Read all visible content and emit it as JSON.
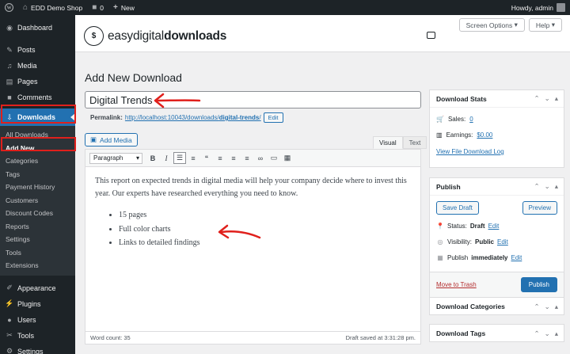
{
  "adminbar": {
    "site_name": "EDD Demo Shop",
    "comments_count": "0",
    "new_label": "New",
    "greeting": "Howdy, admin"
  },
  "sidebar": {
    "top_items": [
      {
        "label": "Dashboard",
        "icon": "dashboard-icon"
      },
      {
        "label": "Posts",
        "icon": "pin-icon"
      },
      {
        "label": "Media",
        "icon": "media-icon"
      },
      {
        "label": "Pages",
        "icon": "pages-icon"
      },
      {
        "label": "Comments",
        "icon": "comment-icon"
      }
    ],
    "downloads_label": "Downloads",
    "submenu": [
      "All Downloads",
      "Add New",
      "Categories",
      "Tags",
      "Payment History",
      "Customers",
      "Discount Codes",
      "Reports",
      "Settings",
      "Tools",
      "Extensions"
    ],
    "bottom_items": [
      {
        "label": "Appearance",
        "icon": "appearance-icon"
      },
      {
        "label": "Plugins",
        "icon": "plugin-icon"
      },
      {
        "label": "Users",
        "icon": "users-icon"
      },
      {
        "label": "Tools",
        "icon": "tools-icon"
      },
      {
        "label": "Settings",
        "icon": "settings-icon"
      }
    ]
  },
  "header": {
    "logo_light1": "easy",
    "logo_light2": "digital",
    "logo_bold": "downloads",
    "screen_options": "Screen Options",
    "help": "Help"
  },
  "page_title": "Add New Download",
  "post_title": "Digital Trends",
  "permalink": {
    "label": "Permalink:",
    "url_base": "http://localhost:10043/downloads/",
    "slug": "digital-trends",
    "url_end": "/",
    "edit_label": "Edit"
  },
  "editor": {
    "add_media": "Add Media",
    "tab_visual": "Visual",
    "tab_text": "Text",
    "format_select": "Paragraph",
    "paragraph": "This report on expected trends in digital media will help your company decide where to invest this year. Our experts have researched everything you need to know.",
    "bullets": [
      "15 pages",
      "Full color charts",
      "Links to detailed findings"
    ],
    "word_count": "Word count: 35",
    "draft_saved": "Draft saved at 3:31:28 pm."
  },
  "download_stats": {
    "title": "Download Stats",
    "sales_label": "Sales:",
    "sales_value": "0",
    "earnings_label": "Earnings:",
    "earnings_value": "$0.00",
    "log_link": "View File Download Log"
  },
  "publish": {
    "title": "Publish",
    "save_draft": "Save Draft",
    "preview": "Preview",
    "status_label": "Status:",
    "status_value": "Draft",
    "visibility_label": "Visibility:",
    "visibility_value": "Public",
    "publish_label": "Publish",
    "publish_when": "immediately",
    "edit": "Edit",
    "trash": "Move to Trash",
    "publish_button": "Publish"
  },
  "categories_box": {
    "title": "Download Categories"
  },
  "tags_box": {
    "title": "Download Tags"
  },
  "colors": {
    "accent": "#2271b1",
    "annotation": "#e0201c",
    "adminbar": "#1d2327"
  }
}
